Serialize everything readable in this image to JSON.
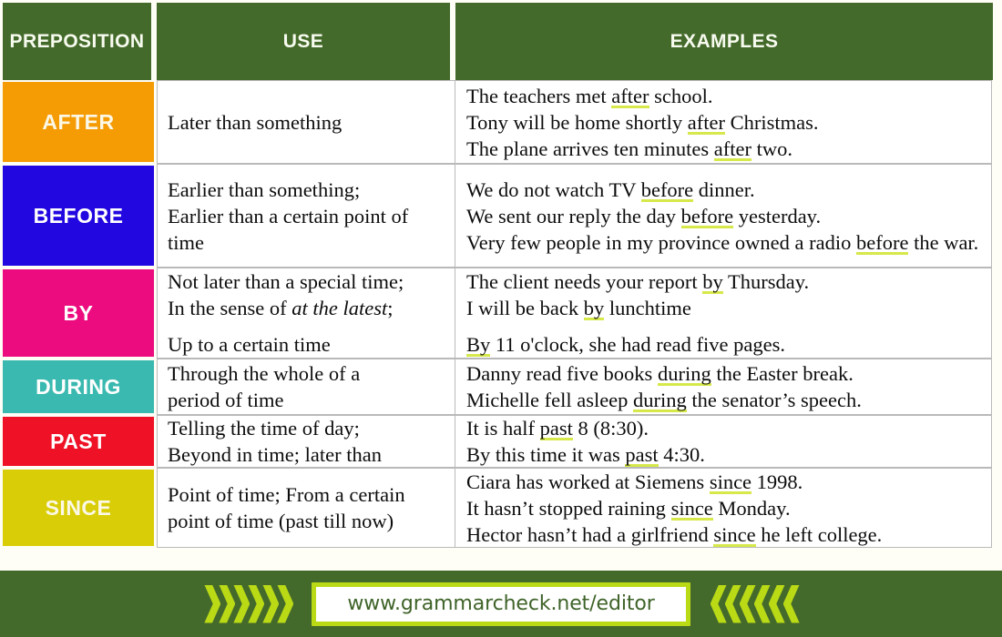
{
  "table": {
    "headers": {
      "preposition": "PREPOSITION",
      "use": "USE",
      "examples": "EXAMPLES"
    },
    "rows": [
      {
        "preposition": "AFTER",
        "color": "#f59c05",
        "use_lines": [
          "Later than something"
        ],
        "example_lines": [
          "The teachers met after school.",
          "Tony will be home shortly after Christmas.",
          "The plane arrives ten minutes after two."
        ],
        "highlight_word": "after"
      },
      {
        "preposition": "BEFORE",
        "color": "#2207e0",
        "use_lines": [
          "Earlier than something;",
          "Earlier than a certain point of time"
        ],
        "example_lines": [
          "We do not watch TV before dinner.",
          "We sent our reply the day before yesterday.",
          "Very few people in my province owned a radio before the war."
        ],
        "highlight_word": "before"
      },
      {
        "preposition": "BY",
        "color": "#ec0c7f",
        "use_lines": [
          "Not later than a special time;",
          "In the sense of at the latest;",
          "Up to a certain time"
        ],
        "use_italic_line": 1,
        "use_italic_text": "at the latest",
        "example_lines": [
          "The client needs your report by Thursday.",
          "I will be back by lunchtime",
          "By 11 o'clock, she had read five pages."
        ],
        "highlight_word": "by"
      },
      {
        "preposition": "DURING",
        "color": "#3ab9b0",
        "use_lines": [
          "Through the whole of a",
          "period of time"
        ],
        "example_lines": [
          "Danny read five books during the Easter break.",
          "Michelle fell asleep during the senator’s speech."
        ],
        "highlight_word": "during"
      },
      {
        "preposition": "PAST",
        "color": "#ef1126",
        "use_lines": [
          "Telling the time of day;",
          "Beyond in time; later than"
        ],
        "example_lines": [
          "It is half past 8 (8:30).",
          "By this time it was past 4:30."
        ],
        "highlight_word": "past"
      },
      {
        "preposition": "SINCE",
        "color": "#d9cd08",
        "use_lines": [
          "Point of time; From a certain",
          "point of time (past till now)"
        ],
        "example_lines": [
          "Ciara has worked at Siemens since 1998.",
          "It hasn’t stopped raining since Monday.",
          "Hector hasn’t had a girlfriend since he left college."
        ],
        "highlight_word": "since"
      }
    ]
  },
  "footer": {
    "url": "www.grammarcheck.net/editor",
    "left_chevrons": 6,
    "right_chevrons": 6,
    "band_color": "#446a2b",
    "chevron_color": "#bada16"
  },
  "theme": {
    "header_green": "#446a2b",
    "page_background": "#fefdf6",
    "highlight": "#d6e84a",
    "cell_border": "#b9b9b9"
  }
}
